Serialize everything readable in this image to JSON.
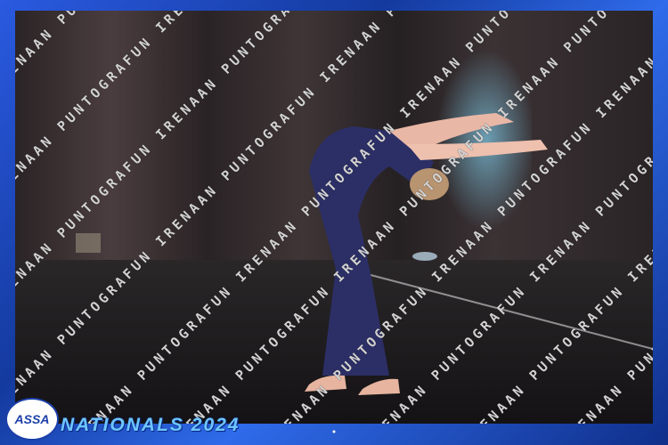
{
  "watermark_text": "IRENAAN PUNTOGRAFUN IRENAAN PUNTOGRAFUN IRENAAN PUNTOGRAFUN IRENAAN",
  "logo_text": "ASSA",
  "caption": "NATIONALS 2024",
  "colors": {
    "frame_blue": "#1a3fb0",
    "caption": "#6ec6ff",
    "costume": "#2c2f66",
    "curtain": "#3a3234",
    "stage_floor": "#1f1d22",
    "spotlight": "#6fb8d8"
  },
  "scene": {
    "subject": "dancer in dark blue leotard performing a back bend on stage",
    "icons": [
      "logo-icon"
    ]
  }
}
